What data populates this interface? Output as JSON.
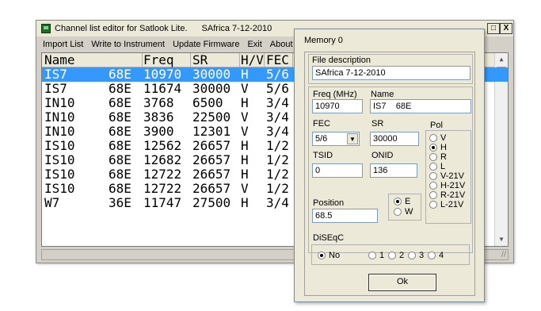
{
  "main_window": {
    "title": "Channel list editor for Satlook Lite.",
    "title_date": "SAfrica 7-12-2010",
    "close_glyph": "X",
    "restore_glyph": "□",
    "menu": [
      "Import List",
      "Write to Instrument",
      "Update Firmware",
      "Exit",
      "About"
    ],
    "columns": [
      "Name",
      "Freq",
      "SR",
      "H/V",
      "FEC"
    ],
    "partial_header": "Я",
    "rows": [
      {
        "name": "IS7",
        "pos": "68E",
        "freq": "10970",
        "sr": "30000",
        "pol": "H",
        "fec": "5/6"
      },
      {
        "name": "IS7",
        "pos": "68E",
        "freq": "11674",
        "sr": "30000",
        "pol": "V",
        "fec": "5/6"
      },
      {
        "name": "IN10",
        "pos": "68E",
        "freq": "3768",
        "sr": "6500",
        "pol": "H",
        "fec": "3/4"
      },
      {
        "name": "IN10",
        "pos": "68E",
        "freq": "3836",
        "sr": "22500",
        "pol": "V",
        "fec": "3/4"
      },
      {
        "name": "IN10",
        "pos": "68E",
        "freq": "3900",
        "sr": "12301",
        "pol": "V",
        "fec": "3/4"
      },
      {
        "name": "IS10",
        "pos": "68E",
        "freq": "12562",
        "sr": "26657",
        "pol": "H",
        "fec": "1/2"
      },
      {
        "name": "IS10",
        "pos": "68E",
        "freq": "12682",
        "sr": "26657",
        "pol": "H",
        "fec": "1/2"
      },
      {
        "name": "IS10",
        "pos": "68E",
        "freq": "12722",
        "sr": "26657",
        "pol": "H",
        "fec": "1/2"
      },
      {
        "name": "IS10",
        "pos": "68E",
        "freq": "12722",
        "sr": "26657",
        "pol": "V",
        "fec": "1/2"
      },
      {
        "name": "W7",
        "pos": "36E",
        "freq": "11747",
        "sr": "27500",
        "pol": "H",
        "fec": "3/4"
      }
    ],
    "selected_row": 0,
    "scroll_up_glyph": "▲",
    "scroll_down_glyph": "▼",
    "grip_glyph": "//"
  },
  "dialog": {
    "title": "Memory 0",
    "file_description_label": "File description",
    "file_description_value": "SAfrica 7-12-2010",
    "freq_label": "Freq (MHz)",
    "freq_value": "10970",
    "name_label": "Name",
    "name_value": "IS7    68E",
    "fec_label": "FEC",
    "fec_value": "5/6",
    "fec_arrow": "▼",
    "sr_label": "SR",
    "sr_value": "30000",
    "pol_label": "Pol",
    "pol_options": [
      "V",
      "H",
      "R",
      "L",
      "V-21V",
      "H-21V",
      "R-21V",
      "L-21V"
    ],
    "pol_selected": "H",
    "tsid_label": "TSID",
    "tsid_value": "0",
    "onid_label": "ONID",
    "onid_value": "136",
    "position_label": "Position",
    "position_value": "68.5",
    "ew_options": [
      "E",
      "W"
    ],
    "ew_selected": "E",
    "diseqc_label": "DiSEqC",
    "diseqc_options": [
      "No",
      "1",
      "2",
      "3",
      "4"
    ],
    "diseqc_selected": "No",
    "ok_label": "Ok"
  },
  "colors": {
    "selection": "#3399ff",
    "window_bg": "#d4d0c8",
    "dialog_bg": "#ece9d8"
  }
}
